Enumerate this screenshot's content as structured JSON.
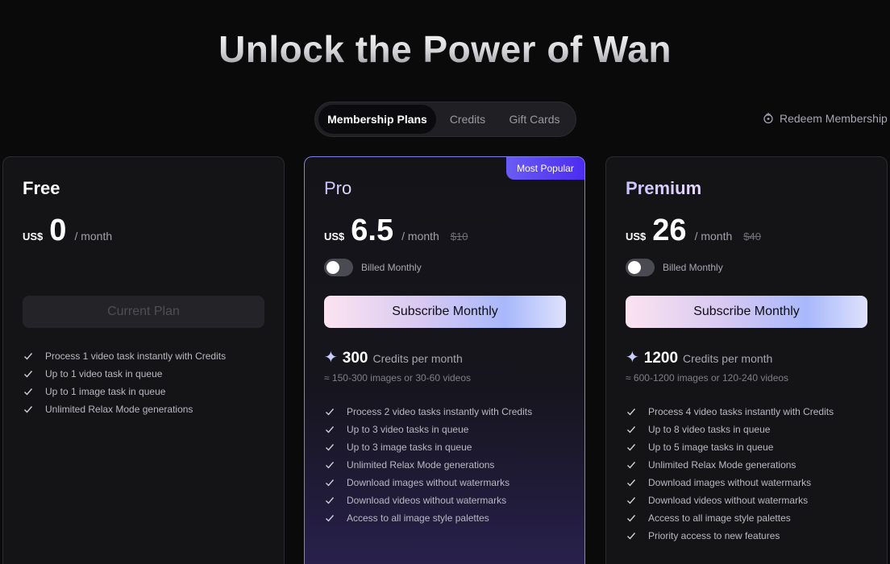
{
  "hero": {
    "title": "Unlock the Power of Wan"
  },
  "tabs": [
    {
      "label": "Membership Plans"
    },
    {
      "label": "Credits"
    },
    {
      "label": "Gift Cards"
    }
  ],
  "redeem": {
    "label": "Redeem Membership"
  },
  "plans": {
    "free": {
      "name": "Free",
      "currency": "US$",
      "price": "0",
      "period": "/ month",
      "button": "Current Plan",
      "features": [
        "Process 1 video task instantly with Credits",
        "Up to 1 video task in queue",
        "Up to 1 image task in queue",
        "Unlimited Relax Mode generations"
      ]
    },
    "pro": {
      "badge": "Most Popular",
      "name": "Pro",
      "currency": "US$",
      "price": "6.5",
      "period": "/ month",
      "old_price": "$10",
      "toggle_label": "Billed Monthly",
      "button": "Subscribe Monthly",
      "credits": "300",
      "credits_unit": "Credits per month",
      "credits_sub": "≈ 150-300 images or 30-60 videos",
      "features": [
        "Process 2 video tasks instantly with Credits",
        "Up to 3 video tasks in queue",
        "Up to 3 image tasks in queue",
        "Unlimited Relax Mode generations",
        "Download images without watermarks",
        "Download videos without watermarks",
        "Access to all image style palettes"
      ]
    },
    "premium": {
      "name": "Premium",
      "currency": "US$",
      "price": "26",
      "period": "/ month",
      "old_price": "$40",
      "toggle_label": "Billed Monthly",
      "button": "Subscribe Monthly",
      "credits": "1200",
      "credits_unit": "Credits per month",
      "credits_sub": "≈ 600-1200 images or 120-240 videos",
      "features": [
        "Process 4 video tasks instantly with Credits",
        "Up to 8 video tasks in queue",
        "Up to 5 image tasks in queue",
        "Unlimited Relax Mode generations",
        "Download images without watermarks",
        "Download videos without watermarks",
        "Access to all image style palettes",
        "Priority access to new features"
      ]
    }
  },
  "colors": {
    "accent": "#7c82e8",
    "badge": "#4c2bf0",
    "background": "#0a0a0b",
    "card": "#141417"
  }
}
